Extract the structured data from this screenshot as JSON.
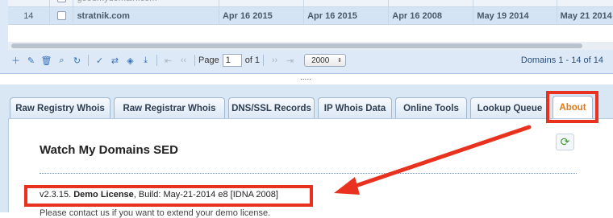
{
  "grid": {
    "partial_row": {
      "domain": "goodmydomain.com",
      "dates": [
        "",
        "",
        "",
        "",
        ""
      ]
    },
    "row": {
      "num": "14",
      "domain": "stratnik.com",
      "dates": [
        "Apr 16 2015",
        "Apr 16 2015",
        "Apr 16 2008",
        "May 19 2014",
        "May 21 2014"
      ]
    }
  },
  "toolbar": {
    "page_label": "Page",
    "page_value": "1",
    "of_label": "of 1",
    "per_page": "2000",
    "status": "Domains 1 - 14 of 14"
  },
  "splitter": {
    "dots": "....."
  },
  "tabs": [
    {
      "label": "Raw Registry Whois"
    },
    {
      "label": "Raw Registrar Whois"
    },
    {
      "label": "DNS/SSL Records"
    },
    {
      "label": "IP Whois Data"
    },
    {
      "label": "Online Tools"
    },
    {
      "label": "Lookup Queue"
    },
    {
      "label": "About"
    }
  ],
  "about": {
    "title": "Watch My Domains SED",
    "version_prefix": "v2.3.15. ",
    "license": "Demo License",
    "build": ", Build: May-21-2014 e8 [IDNA 2008]",
    "next_line": "Please contact us if you want to extend your demo license."
  },
  "colors": {
    "accent": "#e07a18",
    "annotation": "#e8321f",
    "panel": "#d9e6f4"
  }
}
